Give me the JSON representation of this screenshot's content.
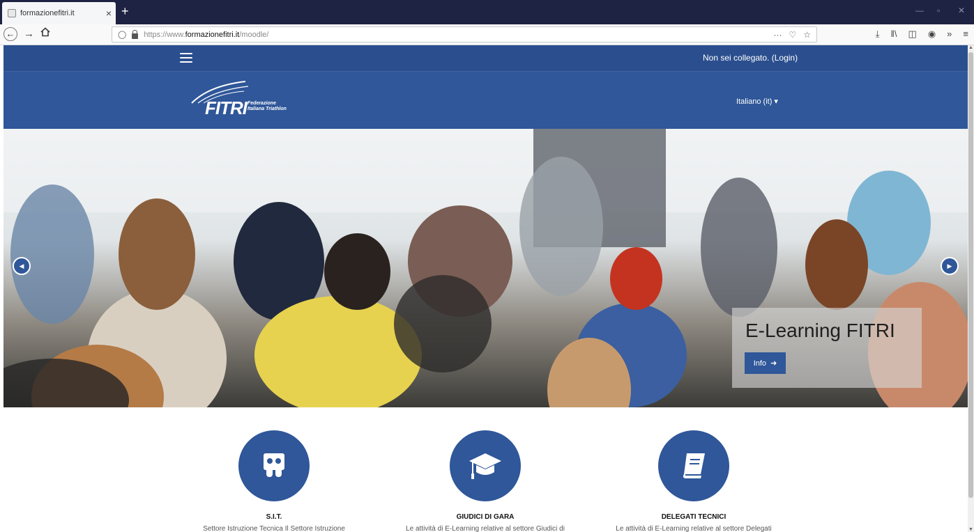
{
  "browser": {
    "tab_title": "formazionefitri.it",
    "tab_close": "×",
    "new_tab": "+",
    "url_prefix": "https://www.",
    "url_domain": "formazionefitri.it",
    "url_path": "/moodle/",
    "url_menu": "···",
    "window_min": "—",
    "window_max": "▫",
    "window_close": "✕"
  },
  "topbar": {
    "login_text": "Non sei collegato. (Login)"
  },
  "header": {
    "logo_main": "FITRI",
    "logo_sub_line1": "Federazione",
    "logo_sub_line2": "Italiana Triathlon",
    "language": "Italiano (it)"
  },
  "hero": {
    "caption_title": "E-Learning FITRI",
    "caption_button": "Info"
  },
  "features": [
    {
      "icon": "slideshare-icon",
      "title": "S.I.T.",
      "desc": "Settore Istruzione Tecnica Il Settore Istruzione"
    },
    {
      "icon": "graduation-cap-icon",
      "title": "GIUDICI DI GARA",
      "desc": "Le attività di E-Learning relative al settore Giudici di"
    },
    {
      "icon": "book-icon",
      "title": "DELEGATI TECNICI",
      "desc": "Le attività di E-Learning relative al settore Delegati"
    }
  ],
  "colors": {
    "primary": "#2f5799",
    "topbar": "#2b4f8e",
    "tabstrip": "#1e2243"
  }
}
